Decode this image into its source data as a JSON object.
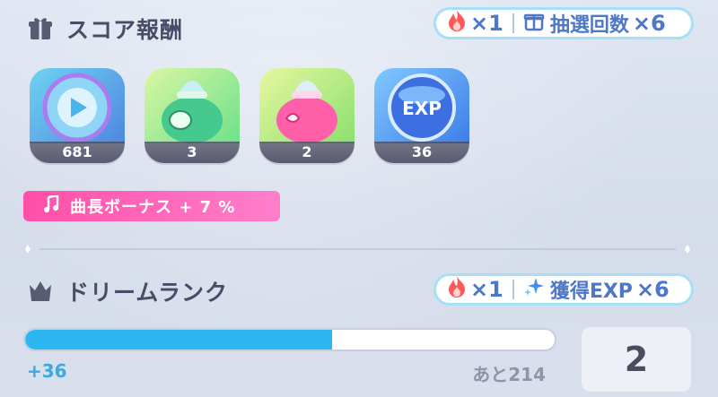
{
  "score_reward": {
    "title": "スコア報酬",
    "fire_mult": "×1",
    "lottery_label": "抽選回数",
    "lottery_mult": "×6",
    "items": [
      {
        "icon": "play-disc-icon",
        "count": "681"
      },
      {
        "icon": "green-pouch-icon",
        "count": "3"
      },
      {
        "icon": "pink-pouch-icon",
        "count": "2"
      },
      {
        "icon": "exp-orb-icon",
        "count": "36",
        "art_text": "EXP"
      }
    ],
    "song_length_bonus": "曲長ボーナス + 7 %"
  },
  "dream_rank": {
    "title": "ドリームランク",
    "fire_mult": "×1",
    "exp_label": "獲得EXP",
    "exp_mult": "×6",
    "progress_fraction": 0.58,
    "gain": "+36",
    "remaining": "あと214",
    "rank": "2"
  },
  "colors": {
    "accent_blue": "#2cb6f2",
    "pill_text": "#4e77c8",
    "tag_pink": "#ff4fa8"
  }
}
